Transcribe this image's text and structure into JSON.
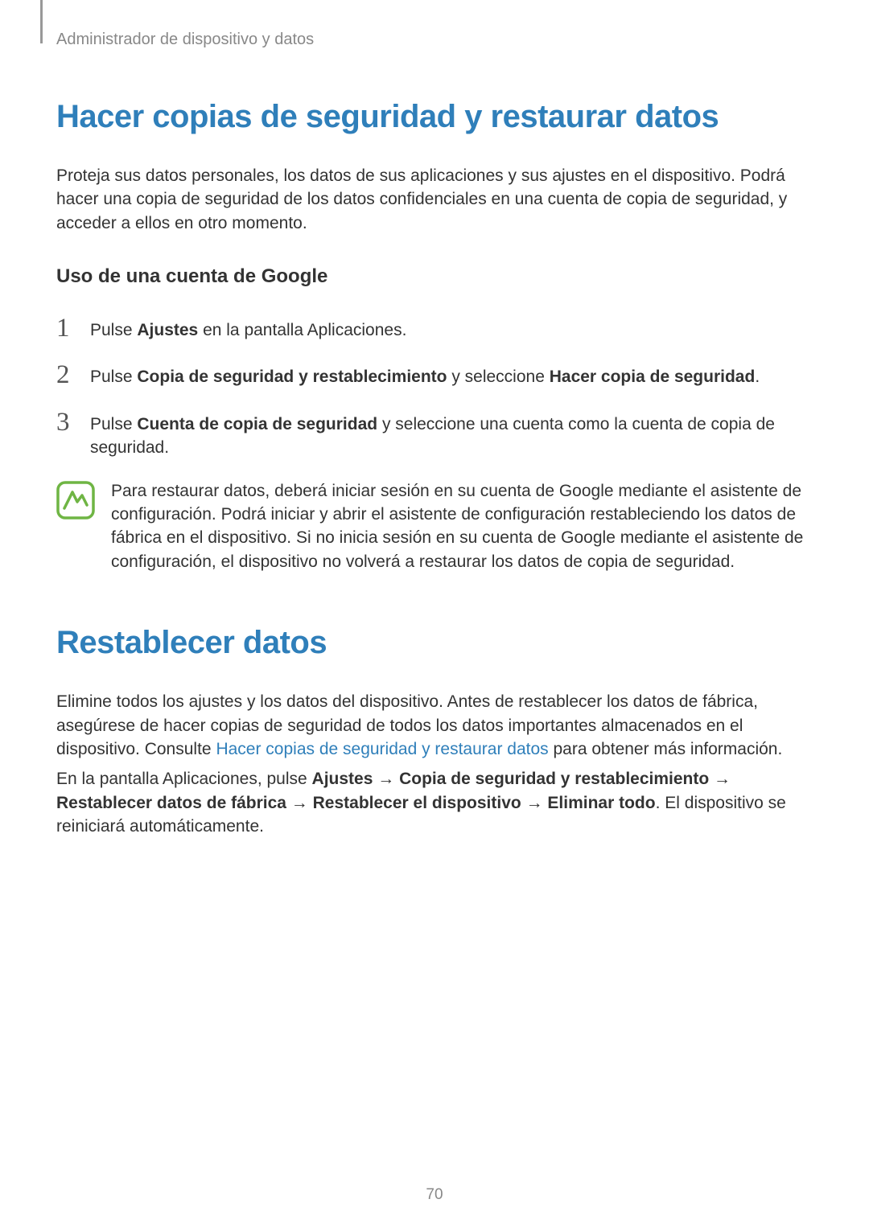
{
  "breadcrumb": "Administrador de dispositivo y datos",
  "section1": {
    "title": "Hacer copias de seguridad y restaurar datos",
    "intro": "Proteja sus datos personales, los datos de sus aplicaciones y sus ajustes en el dispositivo. Podrá hacer una copia de seguridad de los datos confidenciales en una cuenta de copia de seguridad, y acceder a ellos en otro momento.",
    "subheading": "Uso de una cuenta de Google",
    "steps": {
      "s1_pre": "Pulse ",
      "s1_bold": "Ajustes",
      "s1_post": " en la pantalla Aplicaciones.",
      "s2_pre": "Pulse ",
      "s2_bold1": "Copia de seguridad y restablecimiento",
      "s2_mid": " y seleccione ",
      "s2_bold2": "Hacer copia de seguridad",
      "s2_post": ".",
      "s3_pre": "Pulse ",
      "s3_bold": "Cuenta de copia de seguridad",
      "s3_post": " y seleccione una cuenta como la cuenta de copia de seguridad."
    },
    "note": "Para restaurar datos, deberá iniciar sesión en su cuenta de Google mediante el asistente de configuración. Podrá iniciar y abrir el asistente de configuración restableciendo los datos de fábrica en el dispositivo. Si no inicia sesión en su cuenta de Google mediante el asistente de configuración, el dispositivo no volverá a restaurar los datos de copia de seguridad."
  },
  "section2": {
    "title": "Restablecer datos",
    "p1_pre": "Elimine todos los ajustes y los datos del dispositivo. Antes de restablecer los datos de fábrica, asegúrese de hacer copias de seguridad de todos los datos importantes almacenados en el dispositivo. Consulte ",
    "p1_link": "Hacer copias de seguridad y restaurar datos",
    "p1_post": " para obtener más información.",
    "p2_pre": "En la pantalla Aplicaciones, pulse ",
    "p2_b1": "Ajustes",
    "arrow": " → ",
    "p2_b2": "Copia de seguridad y restablecimiento",
    "p2_b3": "Restablecer datos de fábrica",
    "p2_b4": "Restablecer el dispositivo",
    "p2_b5": "Eliminar todo",
    "p2_post": ". El dispositivo se reiniciará automáticamente."
  },
  "pageNumber": "70",
  "nums": {
    "n1": "1",
    "n2": "2",
    "n3": "3"
  }
}
